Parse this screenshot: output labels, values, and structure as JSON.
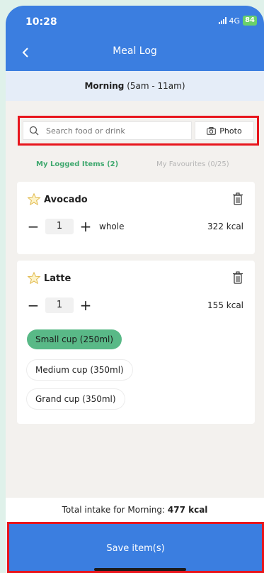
{
  "status": {
    "time": "10:28",
    "network": "4G",
    "battery": "84"
  },
  "header": {
    "title": "Meal Log"
  },
  "period": {
    "name": "Morning",
    "range": "(5am - 11am)"
  },
  "search": {
    "placeholder": "Search food or drink",
    "photo_label": "Photo"
  },
  "tabs": {
    "logged": "My Logged Items (2)",
    "favourites": "My Favourites (0/25)"
  },
  "items": [
    {
      "name": "Avocado",
      "qty": "1",
      "unit": "whole",
      "kcal": "322 kcal"
    },
    {
      "name": "Latte",
      "qty": "1",
      "unit": "",
      "kcal": "155 kcal",
      "sizes": [
        "Small cup (250ml)",
        "Medium cup (350ml)",
        "Grand cup (350ml)"
      ],
      "selected_size": "Small cup (250ml)"
    }
  ],
  "total": {
    "label": "Total intake for Morning:",
    "value": "477 kcal"
  },
  "save": {
    "label": "Save item(s)"
  },
  "colors": {
    "primary": "#3b7ee0",
    "accent_green": "#59b987",
    "highlight_red": "#e8161d"
  },
  "icons": [
    "back-icon",
    "search-icon",
    "camera-icon",
    "star-icon",
    "trash-icon",
    "plus-icon",
    "minus-icon"
  ]
}
